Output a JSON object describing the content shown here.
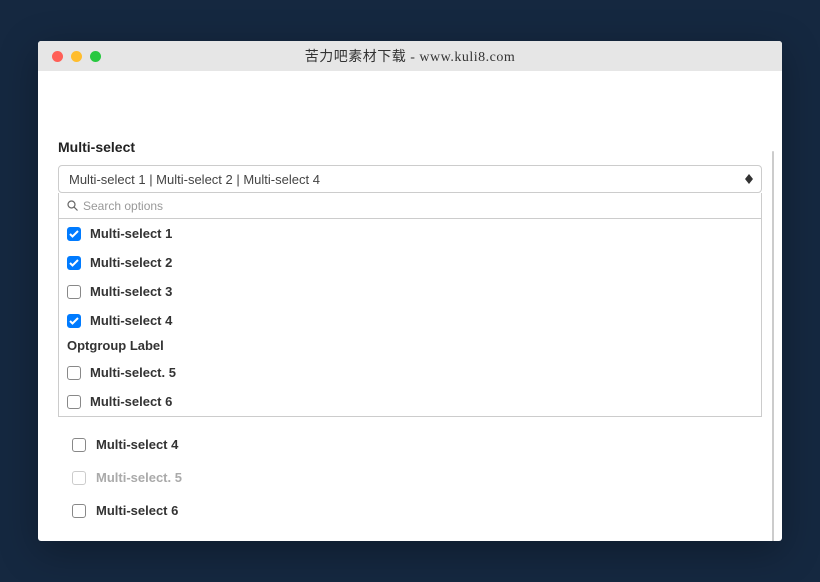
{
  "window": {
    "title": "苦力吧素材下载 - www.kuli8.com"
  },
  "form": {
    "label": "Multi-select",
    "selected_text": "Multi-select 1 | Multi-select 2 | Multi-select 4",
    "search_placeholder": "Search options"
  },
  "dropdown_options": [
    {
      "label": "Multi-select 1",
      "checked": true
    },
    {
      "label": "Multi-select 2",
      "checked": true
    },
    {
      "label": "Multi-select 3",
      "checked": false
    },
    {
      "label": "Multi-select 4",
      "checked": true
    }
  ],
  "optgroup": {
    "label": "Optgroup Label",
    "options": [
      {
        "label": "Multi-select. 5",
        "checked": false
      },
      {
        "label": "Multi-select 6",
        "checked": false
      }
    ]
  },
  "background_options": [
    {
      "label": "Multi-select 4",
      "dim": false
    },
    {
      "label": "Multi-select. 5",
      "dim": true
    },
    {
      "label": "Multi-select 6",
      "dim": false
    }
  ]
}
